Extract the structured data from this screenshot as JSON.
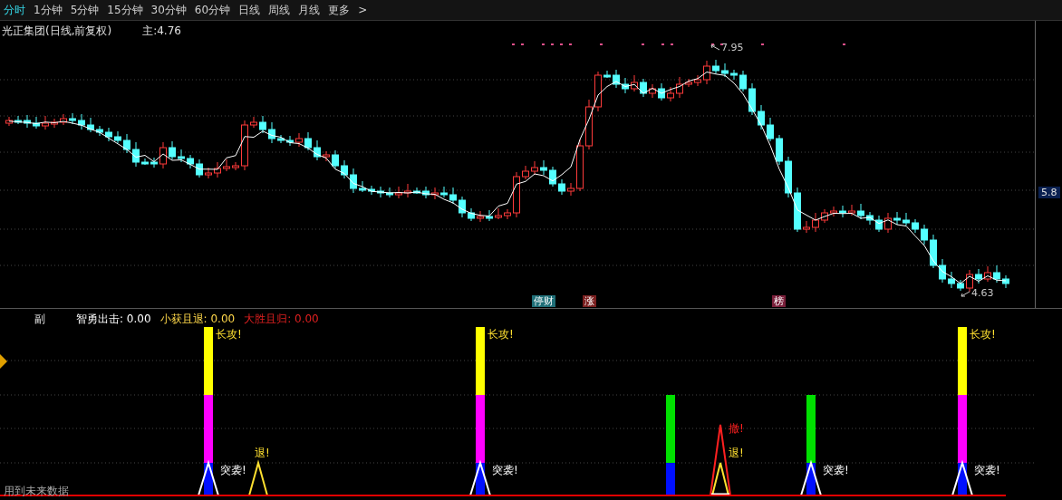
{
  "toolbar": {
    "tabs": [
      {
        "label": "分时",
        "selected": true
      },
      {
        "label": "1分钟",
        "selected": false
      },
      {
        "label": "5分钟",
        "selected": false
      },
      {
        "label": "15分钟",
        "selected": false
      },
      {
        "label": "30分钟",
        "selected": false
      },
      {
        "label": "60分钟",
        "selected": false
      },
      {
        "label": "日线",
        "selected": false
      },
      {
        "label": "周线",
        "selected": false
      },
      {
        "label": "月线",
        "selected": false
      },
      {
        "label": "更多",
        "selected": false
      }
    ],
    "more_arrow": ">"
  },
  "main_chart": {
    "title": "光正集团(日线,前复权)",
    "main_value": "主:4.76",
    "axis_label": "5.8",
    "high_label": "7.95",
    "low_label": "4.63",
    "markers": [
      {
        "label": "停财",
        "color": "#1f6f78"
      },
      {
        "label": "涨",
        "color": "#7a1f1f"
      },
      {
        "label": "榜",
        "color": "#7a1f3a"
      }
    ]
  },
  "indicator": {
    "name": "副",
    "legend": [
      {
        "label": "智勇出击: 0.00",
        "color": "#ffffff"
      },
      {
        "label": "小获且退: 0.00",
        "color": "#ffd84a"
      },
      {
        "label": "大胜且归: 0.00",
        "color": "#e02020"
      }
    ],
    "signals": [
      {
        "kind": "attack",
        "labels": [
          "长攻!",
          "突袭!"
        ]
      },
      {
        "kind": "retreat",
        "labels": [
          "退!"
        ]
      },
      {
        "kind": "attack",
        "labels": [
          "长攻!",
          "突袭!"
        ]
      },
      {
        "kind": "hold"
      },
      {
        "kind": "exit",
        "labels": [
          "撤!",
          "退!"
        ]
      },
      {
        "kind": "raid",
        "labels": [
          "突袭!"
        ]
      },
      {
        "kind": "attack",
        "labels": [
          "长攻!",
          "突袭!"
        ]
      }
    ],
    "footnote": "用到未来数据"
  }
}
